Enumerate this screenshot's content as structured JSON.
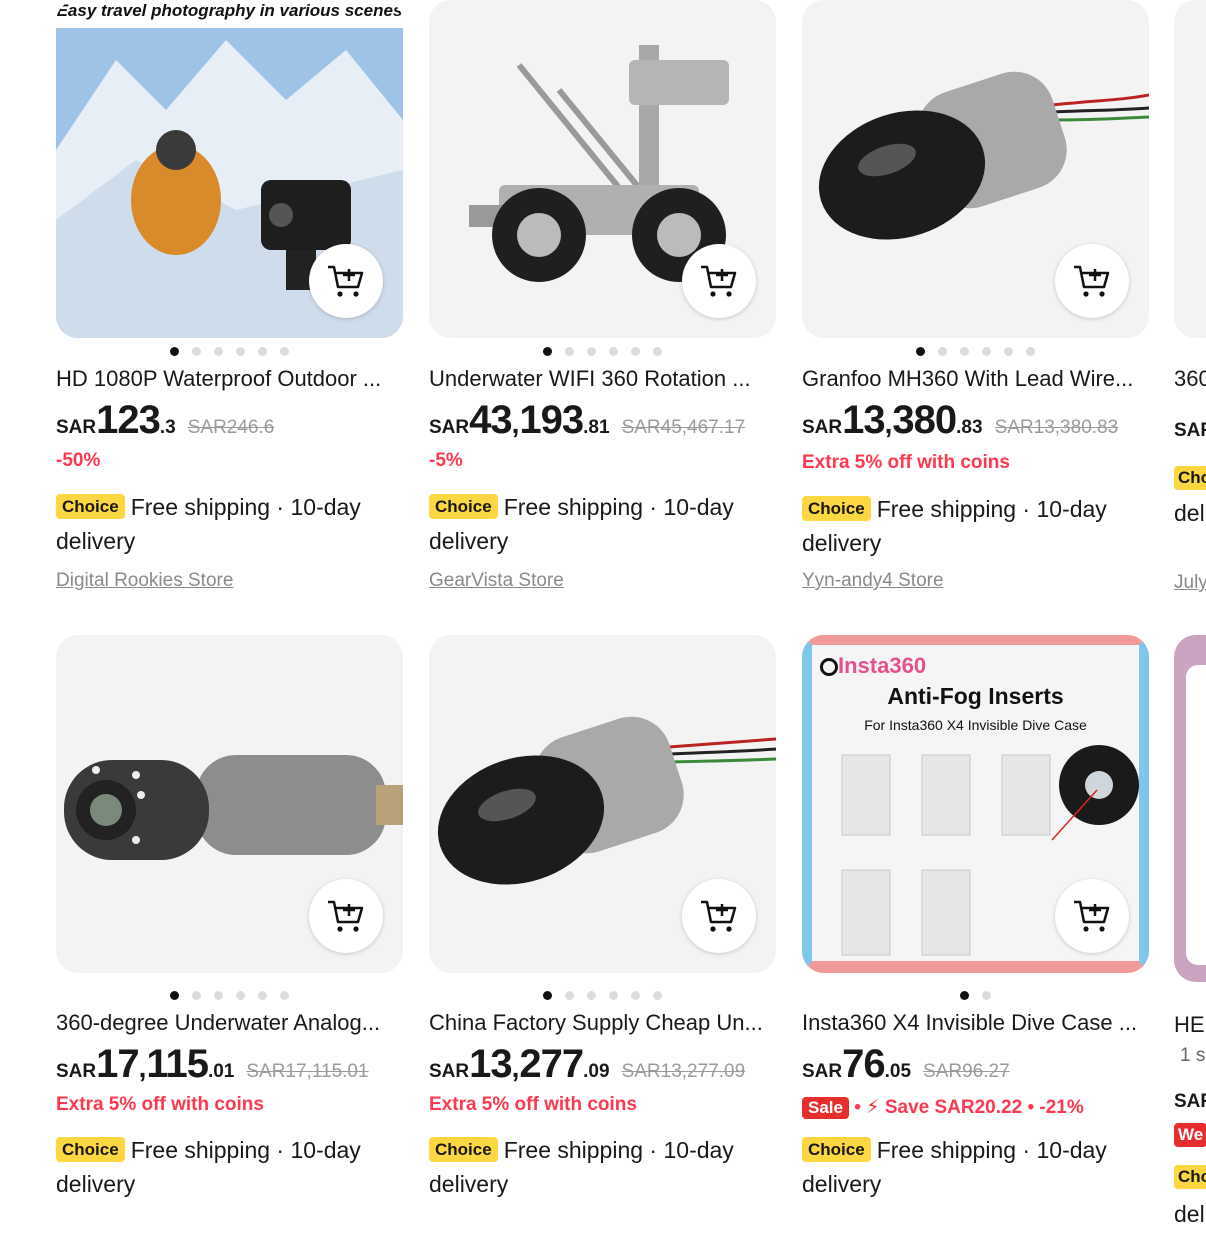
{
  "products": [
    {
      "id": "p1",
      "title": "HD 1080P Waterproof Outdoor ...",
      "image_banner": "Easy travel photography in various scenes",
      "currency": "SAR",
      "price_int": "123",
      "price_dec": ".3",
      "original_price": "SAR246.6",
      "promo": "-50%",
      "choice_label": "Choice",
      "shipping": "Free shipping · 10-day delivery",
      "store": "Digital Rookies Store",
      "dots": 6,
      "active_dot": 0
    },
    {
      "id": "p2",
      "title": "Underwater WIFI 360 Rotation ...",
      "currency": "SAR",
      "price_int_a": "43",
      "price_int_b": "193",
      "price_dec": ".81",
      "original_price": "SAR45,467.17",
      "promo": "-5%",
      "choice_label": "Choice",
      "shipping": "Free shipping · 10-day delivery",
      "store": "GearVista Store",
      "dots": 6,
      "active_dot": 0
    },
    {
      "id": "p3",
      "title": "Granfoo MH360 With Lead Wire...",
      "currency": "SAR",
      "price_int_a": "13",
      "price_int_b": "380",
      "price_dec": ".83",
      "original_price": "SAR13,380.83",
      "promo": "Extra 5% off with coins",
      "choice_label": "Choice",
      "shipping": "Free shipping · 10-day delivery",
      "store": "Yyn-andy4 Store",
      "dots": 6,
      "active_dot": 0
    },
    {
      "id": "p4",
      "title": "360-degree Underwater Analog...",
      "currency": "SAR",
      "price_int_a": "17",
      "price_int_b": "115",
      "price_dec": ".01",
      "original_price": "SAR17,115.01",
      "promo": "Extra 5% off with coins",
      "choice_label": "Choice",
      "shipping": "Free shipping · 10-day delivery",
      "dots": 6,
      "active_dot": 0
    },
    {
      "id": "p5",
      "title": "China Factory Supply Cheap Un...",
      "currency": "SAR",
      "price_int_a": "13",
      "price_int_b": "277",
      "price_dec": ".09",
      "original_price": "SAR13,277.09",
      "promo": "Extra 5% off with coins",
      "choice_label": "Choice",
      "shipping": "Free shipping · 10-day delivery",
      "dots": 6,
      "active_dot": 0
    },
    {
      "id": "p6",
      "title": "Insta360 X4 Invisible Dive Case ...",
      "image_brand": "Insta360",
      "image_heading": "Anti-Fog Inserts",
      "image_sub": "For Insta360 X4 Invisible Dive Case",
      "currency": "SAR",
      "price_int": "76",
      "price_dec": ".05",
      "original_price": "SAR96.27",
      "sale_badge": "Sale",
      "save_text": "Save SAR20.22",
      "save_pct": "-21%",
      "choice_label": "Choice",
      "shipping": "Free shipping · 10-day delivery",
      "dots": 2,
      "active_dot": 0
    }
  ],
  "partial_column": {
    "top_title": "360",
    "top_currency": "SAR",
    "top_choice": "Cho",
    "top_delivery": "del",
    "top_store": "July",
    "bottom_title": "HEI",
    "bottom_sold": "1 s",
    "bottom_currency": "SAR",
    "bottom_badge": "We",
    "bottom_choice": "Cho",
    "bottom_delivery": "del"
  },
  "colors": {
    "promo_red": "#fd384f",
    "choice_yellow": "#fdd741",
    "card_bg": "#f3f3f3"
  }
}
